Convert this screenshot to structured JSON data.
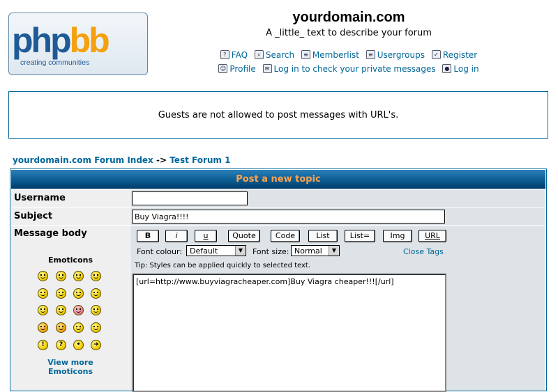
{
  "header": {
    "logo_word_php": "php",
    "logo_word_bb": "bb",
    "logo_tagline": "creating  communities",
    "site_title": "yourdomain.com",
    "site_description": "A _little_ text to describe your forum"
  },
  "nav": {
    "row1": [
      {
        "label": "FAQ",
        "icon": "faq-icon"
      },
      {
        "label": "Search",
        "icon": "search-icon"
      },
      {
        "label": "Memberlist",
        "icon": "memberlist-icon"
      },
      {
        "label": "Usergroups",
        "icon": "usergroups-icon"
      },
      {
        "label": "Register",
        "icon": "register-icon"
      }
    ],
    "row2": [
      {
        "label": "Profile",
        "icon": "profile-icon"
      },
      {
        "label": "Log in to check your private messages",
        "icon": "private-messages-icon"
      },
      {
        "label": "Log in",
        "icon": "login-icon"
      }
    ]
  },
  "info_message": "Guests are not allowed to post messages with URL's.",
  "breadcrumb": {
    "forum_index": "yourdomain.com Forum Index",
    "separator": "->",
    "forum": "Test Forum 1"
  },
  "post_form": {
    "header": "Post a new topic",
    "username_label": "Username",
    "username_value": "",
    "subject_label": "Subject",
    "subject_value": "Buy Viagra!!!!",
    "message_label": "Message body",
    "emoticons_title": "Emoticons",
    "view_more_line1": "View more",
    "view_more_line2": "Emoticons",
    "bbcode_buttons": [
      "B",
      "i",
      "u",
      "Quote",
      "Code",
      "List",
      "List=",
      "Img",
      "URL"
    ],
    "font_colour_label": "Font colour:",
    "font_colour_value": "Default",
    "font_size_label": "Font size:",
    "font_size_value": "Normal",
    "close_tags": "Close Tags",
    "tip": "Tip: Styles can be applied quickly to selected text.",
    "message_value": "[url=http://www.buyviagracheaper.com]Buy Viagra cheaper!!![/url]"
  },
  "colors": {
    "link": "#006699",
    "header_text": "#ffa34f",
    "row1_bg": "#efefef",
    "row2_bg": "#dee3e7"
  }
}
